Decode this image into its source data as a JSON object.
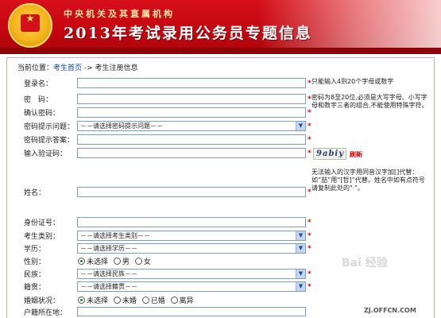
{
  "banner": {
    "org": "中央机关及其直属机构",
    "title": "2013年考试录用公务员专题信息"
  },
  "breadcrumb": {
    "prefix": "当前位置：",
    "home": "考生首页",
    "sep": " -> ",
    "current": "考生注册信息"
  },
  "form": {
    "username": {
      "label": "登录名：",
      "hint": "只能输入4到20个字母或数字"
    },
    "password": {
      "label": "密　码：",
      "hint": "密码为8至20位,必须是大写字母、小写字母和数字三者的组合,不能使用特殊字符。"
    },
    "confirm": {
      "label": "确认密码："
    },
    "question": {
      "label": "密码提示问题：",
      "value": "－－请选择密码提示问题－－"
    },
    "answer": {
      "label": "密码提示答案："
    },
    "captcha": {
      "label": "输入验证码：",
      "image_text": "9abiy",
      "refresh": "刷新"
    },
    "name": {
      "label": "姓名：",
      "hint": "无法输入的汉字用同音汉字加[]代替：如“喆”用“[哲]”代替。姓名中如有点符号请复制此处的\"·\"。"
    },
    "idcard": {
      "label": "身份证号："
    },
    "category": {
      "label": "考生类别：",
      "value": "－－请选择考生类别－－"
    },
    "education": {
      "label": "学历：",
      "value": "－－请选择学历－－"
    },
    "gender": {
      "label": "性别：",
      "options": [
        "未选择",
        "男",
        "女"
      ],
      "selected": 0
    },
    "ethnicity": {
      "label": "民族：",
      "value": "－－请选择民族－－"
    },
    "native": {
      "label": "籍贯：",
      "value": "－－请选择籍贯－－"
    },
    "marital": {
      "label": "婚姻状况：",
      "options": [
        "未选择",
        "未婚",
        "已婚",
        "离异"
      ],
      "selected": 0
    },
    "hukou": {
      "label": "户籍所在地："
    },
    "required_mark": "*"
  },
  "watermark": "Bai 经验",
  "site": "ZJ.OFFCN.COM",
  "colors": {
    "banner_red": "#c2060f",
    "required": "#e00000",
    "link": "#0645ad"
  }
}
